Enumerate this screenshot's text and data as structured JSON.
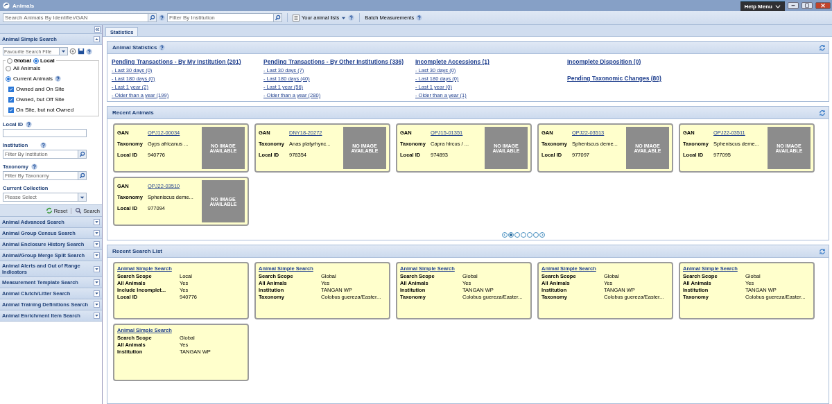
{
  "window": {
    "title": "Animals",
    "help_menu": "Help Menu"
  },
  "toolbar": {
    "search_placeholder": "Search Animals By Identifier/GAN",
    "institution_placeholder": "Filter By Institution",
    "animal_lists": "Your animal lists",
    "batch": "Batch Measurements"
  },
  "sidebar": {
    "simple_search": {
      "title": "Animal Simple Search",
      "favourite_placeholder": "Favourite Search Filte",
      "scope": [
        {
          "label": "Global",
          "selected": false
        },
        {
          "label": "Local",
          "selected": true
        }
      ],
      "animals": [
        {
          "label": "All Animals",
          "selected": false
        },
        {
          "label": "Current Animals",
          "selected": true
        }
      ],
      "checks": [
        {
          "label": "Owned and On Site",
          "checked": true
        },
        {
          "label": "Owned, but Off Site",
          "checked": true
        },
        {
          "label": "On Site, but not Owned",
          "checked": true
        }
      ],
      "local_id_label": "Local ID",
      "institution_label": "Institution",
      "institution_placeholder": "Filter By Institution",
      "taxonomy_label": "Taxonomy",
      "taxonomy_placeholder": "Filter By Taxonomy",
      "collection_label": "Current Collection",
      "collection_placeholder": "Please Select",
      "reset": "Reset",
      "search": "Search"
    },
    "panels": [
      "Animal Advanced Search",
      "Animal Group Census Search",
      "Animal Enclosure History Search",
      "Animal/Group Merge Split Search",
      "Animal Alerts and Out of Range Indicators",
      "Measurement Template Search",
      "Animal Clutch/Litter Search",
      "Animal Training Definitions Search",
      "Animal Enrichment Item Search"
    ]
  },
  "tabs": [
    {
      "label": "Statistics",
      "selected": true
    }
  ],
  "statistics": {
    "title": "Animal Statistics",
    "columns": [
      {
        "heading": "Pending Transactions - By My Institution (201)",
        "links": [
          "- Last 30 days (0)",
          "- Last 180 days (0)",
          "- Last 1 year (2)",
          "- Older than a year (199)"
        ]
      },
      {
        "heading": "Pending Transactions - By Other Institutions (336)",
        "links": [
          "- Last 30 days (7)",
          "- Last 180 days (40)",
          "- Last 1 year (56)",
          "- Older than a year (280)"
        ]
      },
      {
        "heading": "Incomplete Accessions (1)",
        "links": [
          "- Last 30 days (0)",
          "- Last 180 days (0)",
          "- Last 1 year (0)",
          "- Older than a year (1)"
        ]
      },
      {
        "heading": "Incomplete Disposition (0)"
      }
    ],
    "extra_link": "Pending Taxonomic Changes (80)"
  },
  "recent_animals": {
    "title": "Recent Animals",
    "cards": [
      {
        "gan_label": "GAN",
        "gan": "QPJ12-00034",
        "taxonomy_label": "Taxonomy",
        "taxonomy": "Gyps africanus ...",
        "local_id_label": "Local ID",
        "local_id": "940776",
        "no_image": "NO IMAGE AVAILABLE"
      },
      {
        "gan_label": "GAN",
        "gan": "DNY18-20272",
        "taxonomy_label": "Taxonomy",
        "taxonomy": "Anas platyrhync...",
        "local_id_label": "Local ID",
        "local_id": "978354",
        "no_image": "NO IMAGE AVAILABLE"
      },
      {
        "gan_label": "GAN",
        "gan": "QPJ15-01351",
        "taxonomy_label": "Taxonomy",
        "taxonomy": "Capra hircus / ...",
        "local_id_label": "Local ID",
        "local_id": "974893",
        "no_image": "NO IMAGE AVAILABLE"
      },
      {
        "gan_label": "GAN",
        "gan": "QPJ22-03513",
        "taxonomy_label": "Taxonomy",
        "taxonomy": "Spheniscus deme...",
        "local_id_label": "Local ID",
        "local_id": "977097",
        "no_image": "NO IMAGE AVAILABLE"
      },
      {
        "gan_label": "GAN",
        "gan": "QPJ22-03511",
        "taxonomy_label": "Taxonomy",
        "taxonomy": "Spheniscus deme...",
        "local_id_label": "Local ID",
        "local_id": "977095",
        "no_image": "NO IMAGE AVAILABLE"
      },
      {
        "gan_label": "GAN",
        "gan": "QPJ22-03510",
        "taxonomy_label": "Taxonomy",
        "taxonomy": "Spheniscus deme...",
        "local_id_label": "Local ID",
        "local_id": "977094",
        "no_image": "NO IMAGE AVAILABLE"
      }
    ],
    "pager": [
      {
        "selected": true
      },
      {
        "selected": false
      },
      {
        "selected": false
      },
      {
        "selected": false
      },
      {
        "selected": false
      }
    ]
  },
  "recent_searches": {
    "title": "Recent Search List",
    "cards": [
      {
        "title": "Animal Simple Search",
        "rows": [
          [
            "Search Scope",
            "Local"
          ],
          [
            "All Animals",
            "Yes"
          ],
          [
            "Include Incomplet...",
            "Yes"
          ],
          [
            "Local ID",
            "940776"
          ]
        ]
      },
      {
        "title": "Animal Simple Search",
        "rows": [
          [
            "Search Scope",
            "Global"
          ],
          [
            "All Animals",
            "Yes"
          ],
          [
            "Institution",
            "TANGAN WP"
          ],
          [
            "Taxonomy",
            "Colobus guereza/Easter..."
          ]
        ]
      },
      {
        "title": "Animal Simple Search",
        "rows": [
          [
            "Search Scope",
            "Global"
          ],
          [
            "All Animals",
            "Yes"
          ],
          [
            "Institution",
            "TANGAN WP"
          ],
          [
            "Taxonomy",
            "Colobus guereza/Easter..."
          ]
        ]
      },
      {
        "title": "Animal Simple Search",
        "rows": [
          [
            "Search Scope",
            "Global"
          ],
          [
            "All Animals",
            "Yes"
          ],
          [
            "Institution",
            "TANGAN WP"
          ],
          [
            "Taxonomy",
            "Colobus guereza/Easter..."
          ]
        ]
      },
      {
        "title": "Animal Simple Search",
        "rows": [
          [
            "Search Scope",
            "Global"
          ],
          [
            "All Animals",
            "Yes"
          ],
          [
            "Institution",
            "TANGAN WP"
          ],
          [
            "Taxonomy",
            "Colobus guereza/Easter..."
          ]
        ]
      },
      {
        "title": "Animal Simple Search",
        "rows": [
          [
            "Search Scope",
            "Global"
          ],
          [
            "All Animals",
            "Yes"
          ],
          [
            "Institution",
            "TANGAN WP"
          ]
        ]
      }
    ]
  }
}
